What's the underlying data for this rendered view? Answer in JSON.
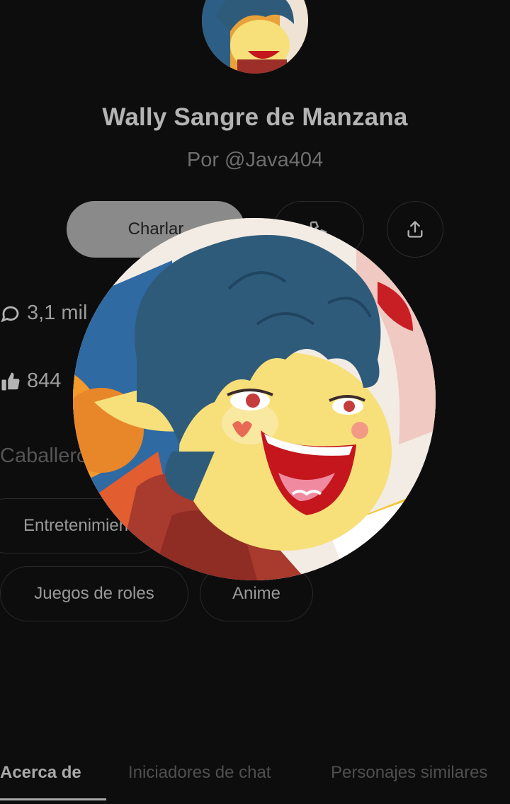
{
  "character": {
    "name": "Wally Sangre de Manzana",
    "author": "Por @Java404"
  },
  "actions": {
    "chat_label": "Charlar",
    "call_icon": "phone-icon",
    "share_icon": "share-icon"
  },
  "stats": {
    "chats": "3,1 mil",
    "likes": "844"
  },
  "category": "Caballero",
  "tags": [
    "Entretenimiento",
    "Juegos de roles",
    "Anime"
  ],
  "tabs": [
    {
      "label": "Acerca de",
      "active": true
    },
    {
      "label": "Iniciadores de chat",
      "active": false
    },
    {
      "label": "Personajes similares",
      "active": false
    }
  ],
  "colors": {
    "background": "#0d0d0e",
    "chat_button": "#8a8a8a",
    "hair": "#2f5b7b",
    "skin": "#f7e07a",
    "mouth": "#c4161c"
  }
}
